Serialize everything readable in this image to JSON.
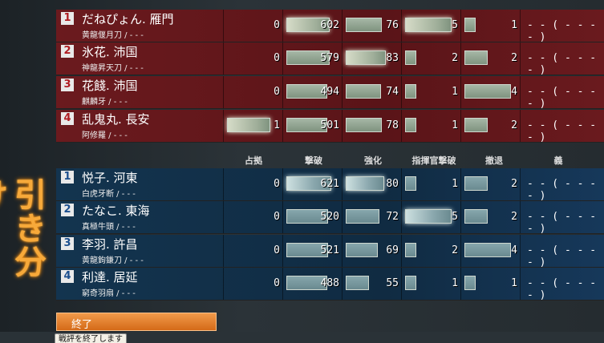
{
  "side_label": "引き分け",
  "headers": [
    "占拠",
    "撃破",
    "強化",
    "指揮官撃破",
    "撤退",
    "義"
  ],
  "red_team": [
    {
      "rank": "1",
      "name": "だねぴょん. 雁門",
      "weapon": "黄龍偃月刀 / - - -",
      "occupy": "0",
      "defeat": "602",
      "defeat_level": 0.85,
      "strengthen": "76",
      "strengthen_level": 0.7,
      "cmd_defeat": "5",
      "cmd_level": 0.9,
      "withdraw": "1",
      "withdraw_level": 0.2,
      "honor": "- - ( - - - - )"
    },
    {
      "rank": "2",
      "name": "氷花. 沛国",
      "weapon": "神龍昇天刀 / - - -",
      "occupy": "0",
      "defeat": "579",
      "defeat_level": 0.85,
      "strengthen": "83",
      "strengthen_level": 0.78,
      "cmd_defeat": "2",
      "cmd_level": 0.0,
      "withdraw": "2",
      "withdraw_level": 0.45,
      "honor": "- - ( - - - - )"
    },
    {
      "rank": "3",
      "name": "花餞. 沛国",
      "weapon": "麒麟牙 / - - -",
      "occupy": "0",
      "defeat": "494",
      "defeat_level": 0.8,
      "strengthen": "74",
      "strengthen_level": 0.68,
      "cmd_defeat": "1",
      "cmd_level": 0.0,
      "withdraw": "4",
      "withdraw_level": 0.9,
      "honor": "- - ( - - - - )"
    },
    {
      "rank": "4",
      "name": "乱鬼丸. 長安",
      "weapon": "阿修羅 / - - -",
      "occupy": "1",
      "occupy_level": 0.85,
      "defeat": "501",
      "defeat_level": 0.8,
      "strengthen": "78",
      "strengthen_level": 0.7,
      "cmd_defeat": "1",
      "cmd_level": 0.0,
      "withdraw": "2",
      "withdraw_level": 0.45,
      "honor": "- - ( - - - - )"
    }
  ],
  "blue_team": [
    {
      "rank": "1",
      "name": "悦子. 河東",
      "weapon": "白虎牙断 / - - -",
      "occupy": "0",
      "defeat": "621",
      "defeat_level": 0.87,
      "strengthen": "80",
      "strengthen_level": 0.75,
      "cmd_defeat": "1",
      "cmd_level": 0.0,
      "withdraw": "2",
      "withdraw_level": 0.45,
      "honor": "- - ( - - - - )"
    },
    {
      "rank": "2",
      "name": "たなこ. 東海",
      "weapon": "真極牛頭 / - - -",
      "occupy": "0",
      "defeat": "520",
      "defeat_level": 0.82,
      "strengthen": "72",
      "strengthen_level": 0.66,
      "cmd_defeat": "5",
      "cmd_level": 0.9,
      "withdraw": "2",
      "withdraw_level": 0.45,
      "honor": "- - ( - - - - )"
    },
    {
      "rank": "3",
      "name": "李羽. 許昌",
      "weapon": "黄龍鉤鎌刀 / - - -",
      "occupy": "0",
      "defeat": "521",
      "defeat_level": 0.82,
      "strengthen": "69",
      "strengthen_level": 0.62,
      "cmd_defeat": "2",
      "cmd_level": 0.0,
      "withdraw": "4",
      "withdraw_level": 0.9,
      "honor": "- - ( - - - - )"
    },
    {
      "rank": "4",
      "name": "利達. 居延",
      "weapon": "窮奇羽扇 / - - -",
      "occupy": "0",
      "defeat": "488",
      "defeat_level": 0.8,
      "strengthen": "55",
      "strengthen_level": 0.45,
      "cmd_defeat": "1",
      "cmd_level": 0.0,
      "withdraw": "1",
      "withdraw_level": 0.2,
      "honor": "- - ( - - - - )"
    }
  ],
  "end_button_label": "終了",
  "tooltip": "戦評を終了します"
}
